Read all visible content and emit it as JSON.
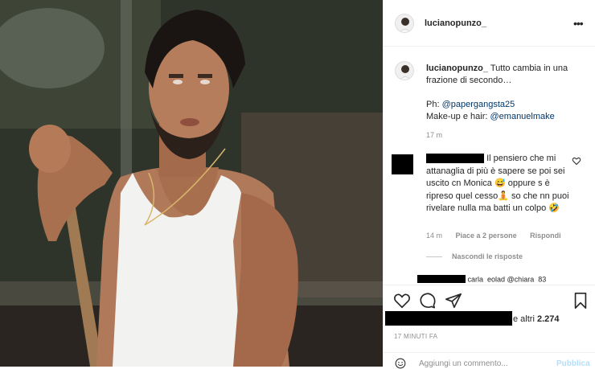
{
  "post": {
    "username": "lucianopunzo_",
    "more_icon": "ellipsis-icon",
    "caption": {
      "username": "lucianopunzo_",
      "text": "Tutto cambia in una frazione di secondo…",
      "ph_label": "Ph:",
      "ph_mention": "@papergangsta25",
      "mua_label": "Make-up e hair:",
      "mua_mention": "@emanuelmake",
      "time": "17 m"
    },
    "comment": {
      "text": "Il pensiero che mi attanaglia di più è sapere se poi sei uscito cn Monica 😅 oppure s è ripreso quel cesso🧘 so che nn puoi rivelare nulla ma batti un colpo 🤣",
      "time": "14 m",
      "likes": "Piace a 2 persone",
      "reply": "Rispondi",
      "hide_replies": "Nascondi le risposte"
    },
    "reply_preview": "carla_eolad @chiara_83",
    "likes_suffix": "e altri",
    "likes_count": "2.274",
    "post_time": "17 MINUTI FA",
    "add_comment_placeholder": "Aggiungi un commento...",
    "publish_label": "Pubblica"
  },
  "colors": {
    "link": "#00376b",
    "muted": "#8e8e8e",
    "publish": "#b2dffc"
  }
}
